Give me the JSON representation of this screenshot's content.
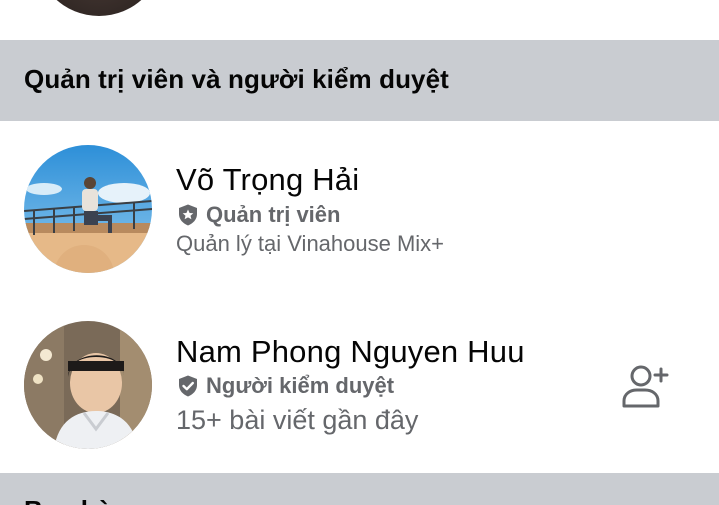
{
  "sections": {
    "admins_moderators": {
      "title": "Quản trị viên và người kiểm duyệt"
    },
    "next": {
      "title": "Bạn bè"
    }
  },
  "members": [
    {
      "name": "Võ Trọng Hải",
      "role": "Quản trị viên",
      "role_icon": "admin-shield-star-icon",
      "subtitle": "Quản lý tại Vinahouse Mix+"
    },
    {
      "name": "Nam Phong Nguyen Huu",
      "role": "Người kiểm duyệt",
      "role_icon": "moderator-shield-check-icon",
      "subtitle": "15+ bài viết gần đây",
      "action_icon": "add-friend-icon"
    }
  ],
  "colors": {
    "section_bg": "#c9ccd1",
    "primary_text": "#050505",
    "secondary_text": "#65676b"
  }
}
